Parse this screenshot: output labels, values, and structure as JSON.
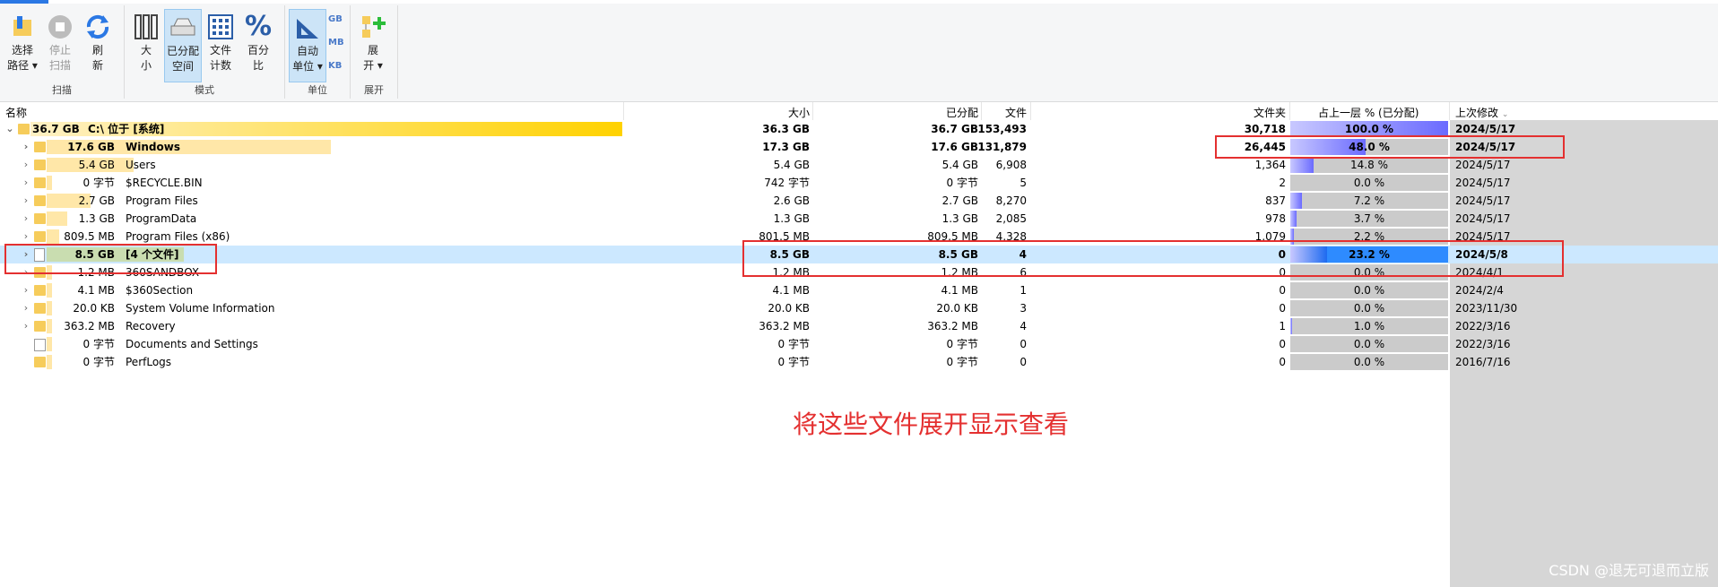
{
  "ribbon": {
    "groups": {
      "scan": "扫描",
      "mode": "模式",
      "unit": "单位",
      "expand": "展开"
    },
    "buttons": {
      "select_path": [
        "选择",
        "路径 ▾"
      ],
      "stop_scan": [
        "停止",
        "扫描"
      ],
      "refresh": [
        "刷",
        "新"
      ],
      "size": [
        "大",
        "小"
      ],
      "allocated": [
        "已分配",
        "空间"
      ],
      "file_count": [
        "文件",
        "计数"
      ],
      "percent": [
        "百分",
        "比"
      ],
      "auto_unit": [
        "自动",
        "单位 ▾"
      ],
      "expand": [
        "展",
        "开 ▾"
      ]
    },
    "units": [
      "GB",
      "MB",
      "KB"
    ]
  },
  "columns": {
    "name": "名称",
    "size": "大小",
    "allocated": "已分配",
    "files": "文件",
    "folders": "文件夹",
    "parent_pct": "占上一层 % (已分配)",
    "modified": "上次修改"
  },
  "rows": [
    {
      "sizeText": "36.7 GB",
      "name": "C:\\  位于  [系统]",
      "size": "36.3 GB",
      "alloc": "36.7 GB",
      "files": "153,493",
      "folders": "30,718",
      "pct": "100.0 %",
      "pctVal": 100,
      "mod": "2024/5/17"
    },
    {
      "sizeText": "17.6 GB",
      "name": "Windows",
      "size": "17.3 GB",
      "alloc": "17.6 GB",
      "files": "131,879",
      "folders": "26,445",
      "pct": "48.0 %",
      "pctVal": 48,
      "mod": "2024/5/17"
    },
    {
      "sizeText": "5.4 GB",
      "name": "Users",
      "size": "5.4 GB",
      "alloc": "5.4 GB",
      "files": "6,908",
      "folders": "1,364",
      "pct": "14.8 %",
      "pctVal": 14.8,
      "mod": "2024/5/17"
    },
    {
      "sizeText": "0 字节",
      "name": "$RECYCLE.BIN",
      "size": "742 字节",
      "alloc": "0 字节",
      "files": "5",
      "folders": "2",
      "pct": "0.0 %",
      "pctVal": 0,
      "mod": "2024/5/17"
    },
    {
      "sizeText": "2.7 GB",
      "name": "Program Files",
      "size": "2.6 GB",
      "alloc": "2.7 GB",
      "files": "8,270",
      "folders": "837",
      "pct": "7.2 %",
      "pctVal": 7.2,
      "mod": "2024/5/17"
    },
    {
      "sizeText": "1.3 GB",
      "name": "ProgramData",
      "size": "1.3 GB",
      "alloc": "1.3 GB",
      "files": "2,085",
      "folders": "978",
      "pct": "3.7 %",
      "pctVal": 3.7,
      "mod": "2024/5/17"
    },
    {
      "sizeText": "809.5 MB",
      "name": "Program Files (x86)",
      "size": "801.5 MB",
      "alloc": "809.5 MB",
      "files": "4,328",
      "folders": "1,079",
      "pct": "2.2 %",
      "pctVal": 2.2,
      "mod": "2024/5/17"
    },
    {
      "sizeText": "8.5 GB",
      "name": "[4 个文件]",
      "size": "8.5 GB",
      "alloc": "8.5 GB",
      "files": "4",
      "folders": "0",
      "pct": "23.2 %",
      "pctVal": 23.2,
      "mod": "2024/5/8"
    },
    {
      "sizeText": "1.2 MB",
      "name": "360SANDBOX",
      "size": "1.2 MB",
      "alloc": "1.2 MB",
      "files": "6",
      "folders": "0",
      "pct": "0.0 %",
      "pctVal": 0,
      "mod": "2024/4/1"
    },
    {
      "sizeText": "4.1 MB",
      "name": "$360Section",
      "size": "4.1 MB",
      "alloc": "4.1 MB",
      "files": "1",
      "folders": "0",
      "pct": "0.0 %",
      "pctVal": 0,
      "mod": "2024/2/4"
    },
    {
      "sizeText": "20.0 KB",
      "name": "System Volume Information",
      "size": "20.0 KB",
      "alloc": "20.0 KB",
      "files": "3",
      "folders": "0",
      "pct": "0.0 %",
      "pctVal": 0,
      "mod": "2023/11/30"
    },
    {
      "sizeText": "363.2 MB",
      "name": "Recovery",
      "size": "363.2 MB",
      "alloc": "363.2 MB",
      "files": "4",
      "folders": "1",
      "pct": "1.0 %",
      "pctVal": 1,
      "mod": "2022/3/16"
    },
    {
      "sizeText": "0 字节",
      "name": "Documents and Settings",
      "size": "0 字节",
      "alloc": "0 字节",
      "files": "0",
      "folders": "0",
      "pct": "0.0 %",
      "pctVal": 0,
      "mod": "2022/3/16"
    },
    {
      "sizeText": "0 字节",
      "name": "PerfLogs",
      "size": "0 字节",
      "alloc": "0 字节",
      "files": "0",
      "folders": "0",
      "pct": "0.0 %",
      "pctVal": 0,
      "mod": "2016/7/16"
    }
  ],
  "annotation": "将这些文件展开显示查看",
  "watermark": "CSDN @退无可退而立版",
  "colors": {
    "annotation_red": "#e43030",
    "selection": "#cce8ff",
    "folder": "#f6cc5b",
    "pct_fill": "#6b6bff"
  }
}
